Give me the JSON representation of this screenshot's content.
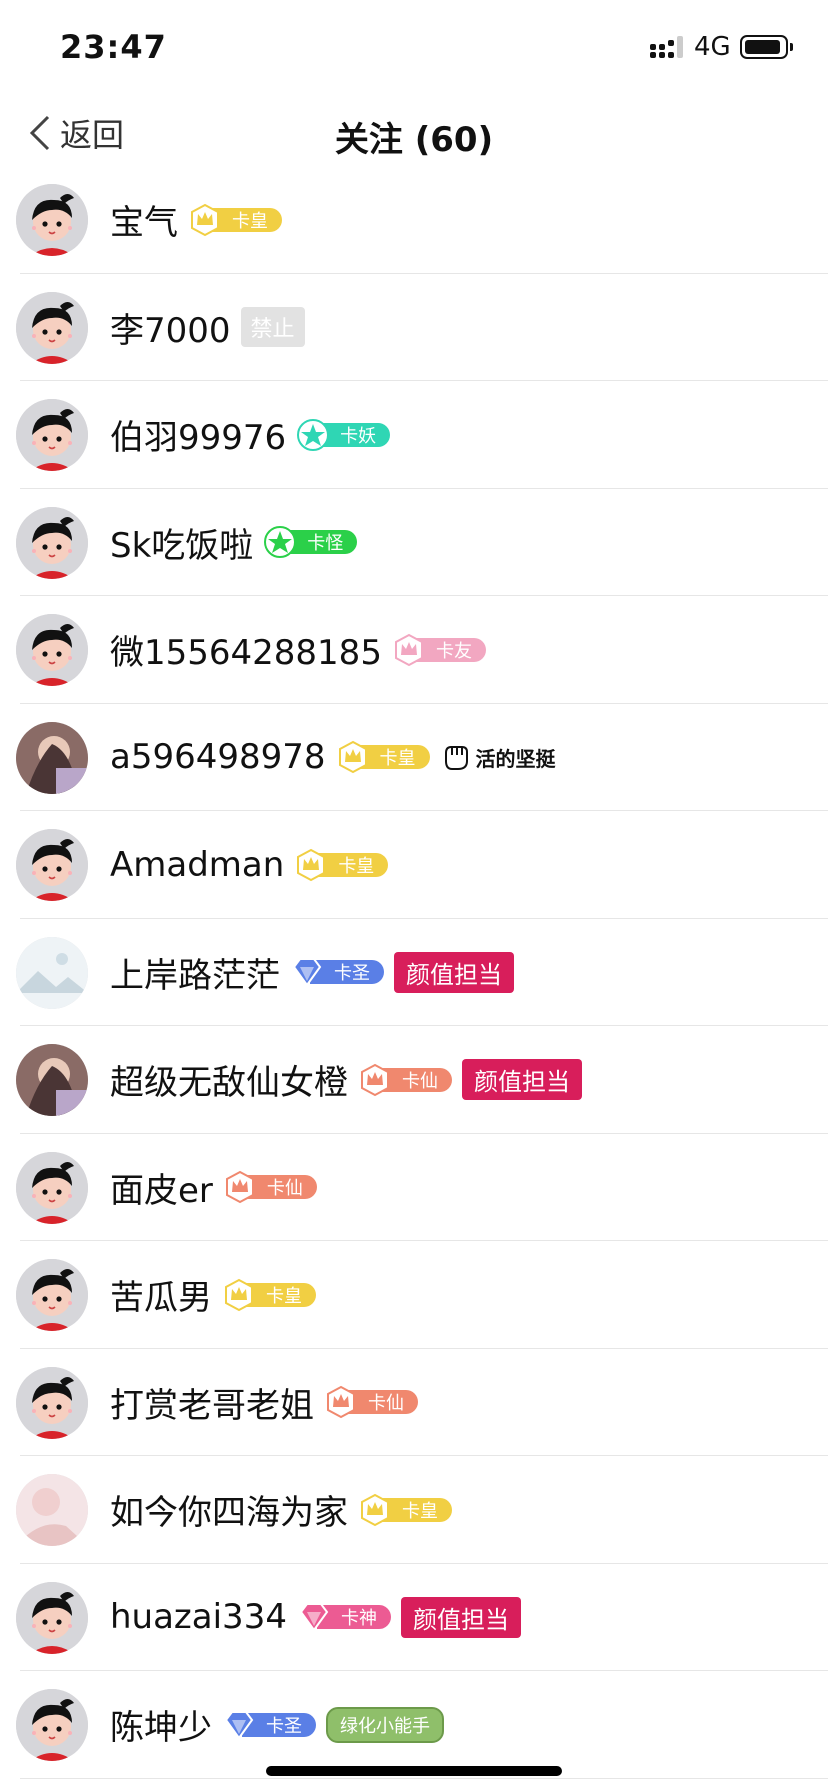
{
  "status_bar": {
    "time": "23:47",
    "network": "4G"
  },
  "nav": {
    "back_label": "返回",
    "title": "关注 (60)"
  },
  "colors": {
    "卡皇": "#f1cf43",
    "卡妖": "#2fd6b4",
    "卡怪": "#2bd049",
    "卡友": "#f2a7c1",
    "卡圣": "#5a7fe6",
    "卡仙": "#f0886e",
    "卡神": "#ec5b93"
  },
  "users": [
    {
      "name": "宝气",
      "level": "卡皇",
      "gem": "crown-icon"
    },
    {
      "name": "李7000",
      "ban": "禁止"
    },
    {
      "name": "伯羽99976",
      "level": "卡妖",
      "gem": "star-icon"
    },
    {
      "name": "Sk吃饭啦",
      "level": "卡怪",
      "gem": "star-icon"
    },
    {
      "name": "微15564288185",
      "level": "卡友",
      "gem": "crown-icon"
    },
    {
      "name": "a596498978",
      "level": "卡皇",
      "gem": "crown-icon",
      "medal": "活的坚挺",
      "avatar": "photo"
    },
    {
      "name": "Amadman",
      "level": "卡皇",
      "gem": "crown-icon"
    },
    {
      "name": "上岸路茫茫",
      "level": "卡圣",
      "gem": "diamond-icon",
      "tag": "颜值担当",
      "avatar": "landscape"
    },
    {
      "name": "超级无敌仙女橙",
      "level": "卡仙",
      "gem": "crown-icon",
      "tag": "颜值担当",
      "avatar": "photo"
    },
    {
      "name": "面皮er",
      "level": "卡仙",
      "gem": "crown-icon"
    },
    {
      "name": "苦瓜男",
      "level": "卡皇",
      "gem": "crown-icon"
    },
    {
      "name": "打赏老哥老姐",
      "level": "卡仙",
      "gem": "crown-icon"
    },
    {
      "name": "如今你四海为家",
      "level": "卡皇",
      "gem": "crown-icon",
      "avatar": "photo-light"
    },
    {
      "name": "huazai334",
      "level": "卡神",
      "gem": "diamond-icon",
      "tag": "颜值担当"
    },
    {
      "name": "陈坤少",
      "level": "卡圣",
      "gem": "diamond-icon",
      "badge2": "绿化小能手"
    }
  ]
}
